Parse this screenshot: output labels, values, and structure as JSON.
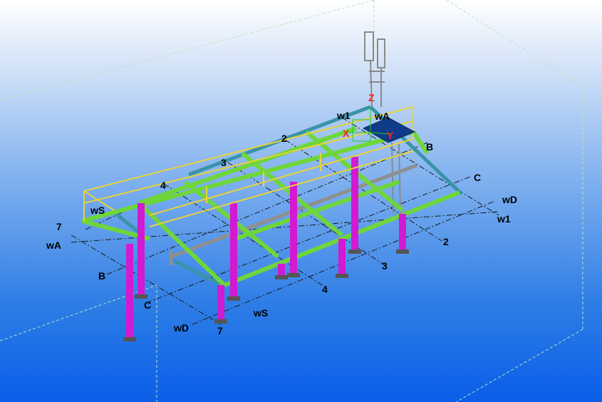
{
  "colors": {
    "column": "#d21ad2",
    "beam_green": "#6fd63a",
    "beam_teal": "#3a93a8",
    "beam_grey": "#8f8f8f",
    "railing": "#e8d23a",
    "platform": "#103a8a",
    "axis_x": "#ff2020",
    "axis_y": "#ff2020",
    "axis_z": "#ff2020",
    "gridline": "#1a1a1a",
    "bbox": "#b8e6b8"
  },
  "icons": {
    "axis_glyph": "xyz-axis-icon"
  },
  "axis_labels": {
    "x": "X",
    "y": "Y",
    "z": "Z"
  },
  "grid_labels": {
    "top_row": {
      "w1": "w1",
      "wA": "wA",
      "two": "2",
      "three": "3",
      "four": "4",
      "wS": "wS",
      "seven": "7",
      "B": "B",
      "C": "C",
      "wD": "wD"
    },
    "left_col": {
      "seven": "7",
      "wA": "wA",
      "B": "B",
      "C": "C",
      "wD": "wD"
    },
    "right_col": {
      "w1": "w1",
      "two": "2",
      "three": "3",
      "four": "4",
      "wS": "wS",
      "seven": "7"
    }
  }
}
